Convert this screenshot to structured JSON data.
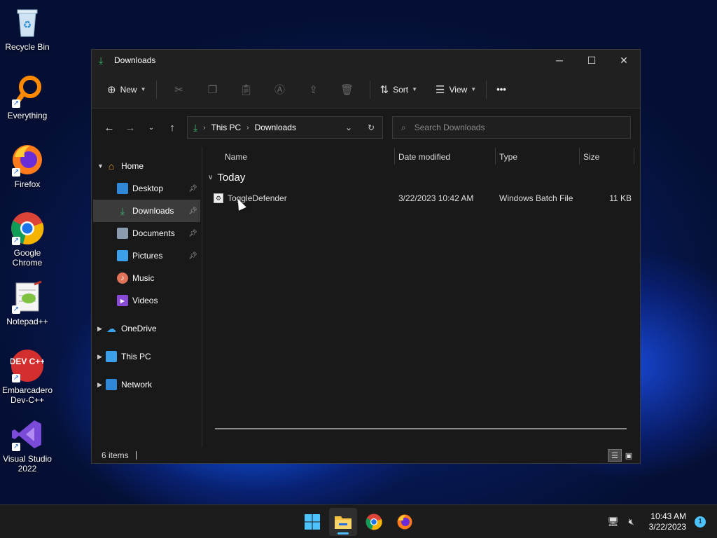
{
  "desktop": {
    "icons": [
      {
        "label": "Recycle Bin"
      },
      {
        "label": "Everything"
      },
      {
        "label": "Firefox"
      },
      {
        "label": "Google Chrome"
      },
      {
        "label": "Notepad++"
      },
      {
        "label": "Embarcadero Dev-C++"
      },
      {
        "label": "Visual Studio 2022"
      }
    ],
    "devcpp_text": "DEV C++"
  },
  "window": {
    "title": "Downloads",
    "controls": {
      "minimize": "─",
      "maximize": "☐",
      "close": "✕"
    }
  },
  "toolbar": {
    "new_label": "New",
    "sort_label": "Sort",
    "view_label": "View",
    "more_label": "•••"
  },
  "address": {
    "crumbs": [
      "This PC",
      "Downloads"
    ]
  },
  "search": {
    "placeholder": "Search Downloads"
  },
  "sidebar": {
    "home": "Home",
    "quick": [
      {
        "label": "Desktop",
        "pinned": true
      },
      {
        "label": "Downloads",
        "pinned": true
      },
      {
        "label": "Documents",
        "pinned": true
      },
      {
        "label": "Pictures",
        "pinned": true
      },
      {
        "label": "Music",
        "pinned": false
      },
      {
        "label": "Videos",
        "pinned": false
      }
    ],
    "roots": [
      {
        "label": "OneDrive"
      },
      {
        "label": "This PC"
      },
      {
        "label": "Network"
      }
    ]
  },
  "columns": {
    "name": "Name",
    "date": "Date modified",
    "type": "Type",
    "size": "Size"
  },
  "group_label": "Today",
  "files": [
    {
      "name": "ToggleDefender",
      "date": "3/22/2023 10:42 AM",
      "type": "Windows Batch File",
      "size": "11 KB"
    }
  ],
  "status": {
    "items": "6 items"
  },
  "taskbar": {
    "time": "10:43 AM",
    "date": "3/22/2023",
    "notifications": "1"
  },
  "colors": {
    "accent": "#4cc2ff",
    "downloads_green": "#3bb36a"
  }
}
